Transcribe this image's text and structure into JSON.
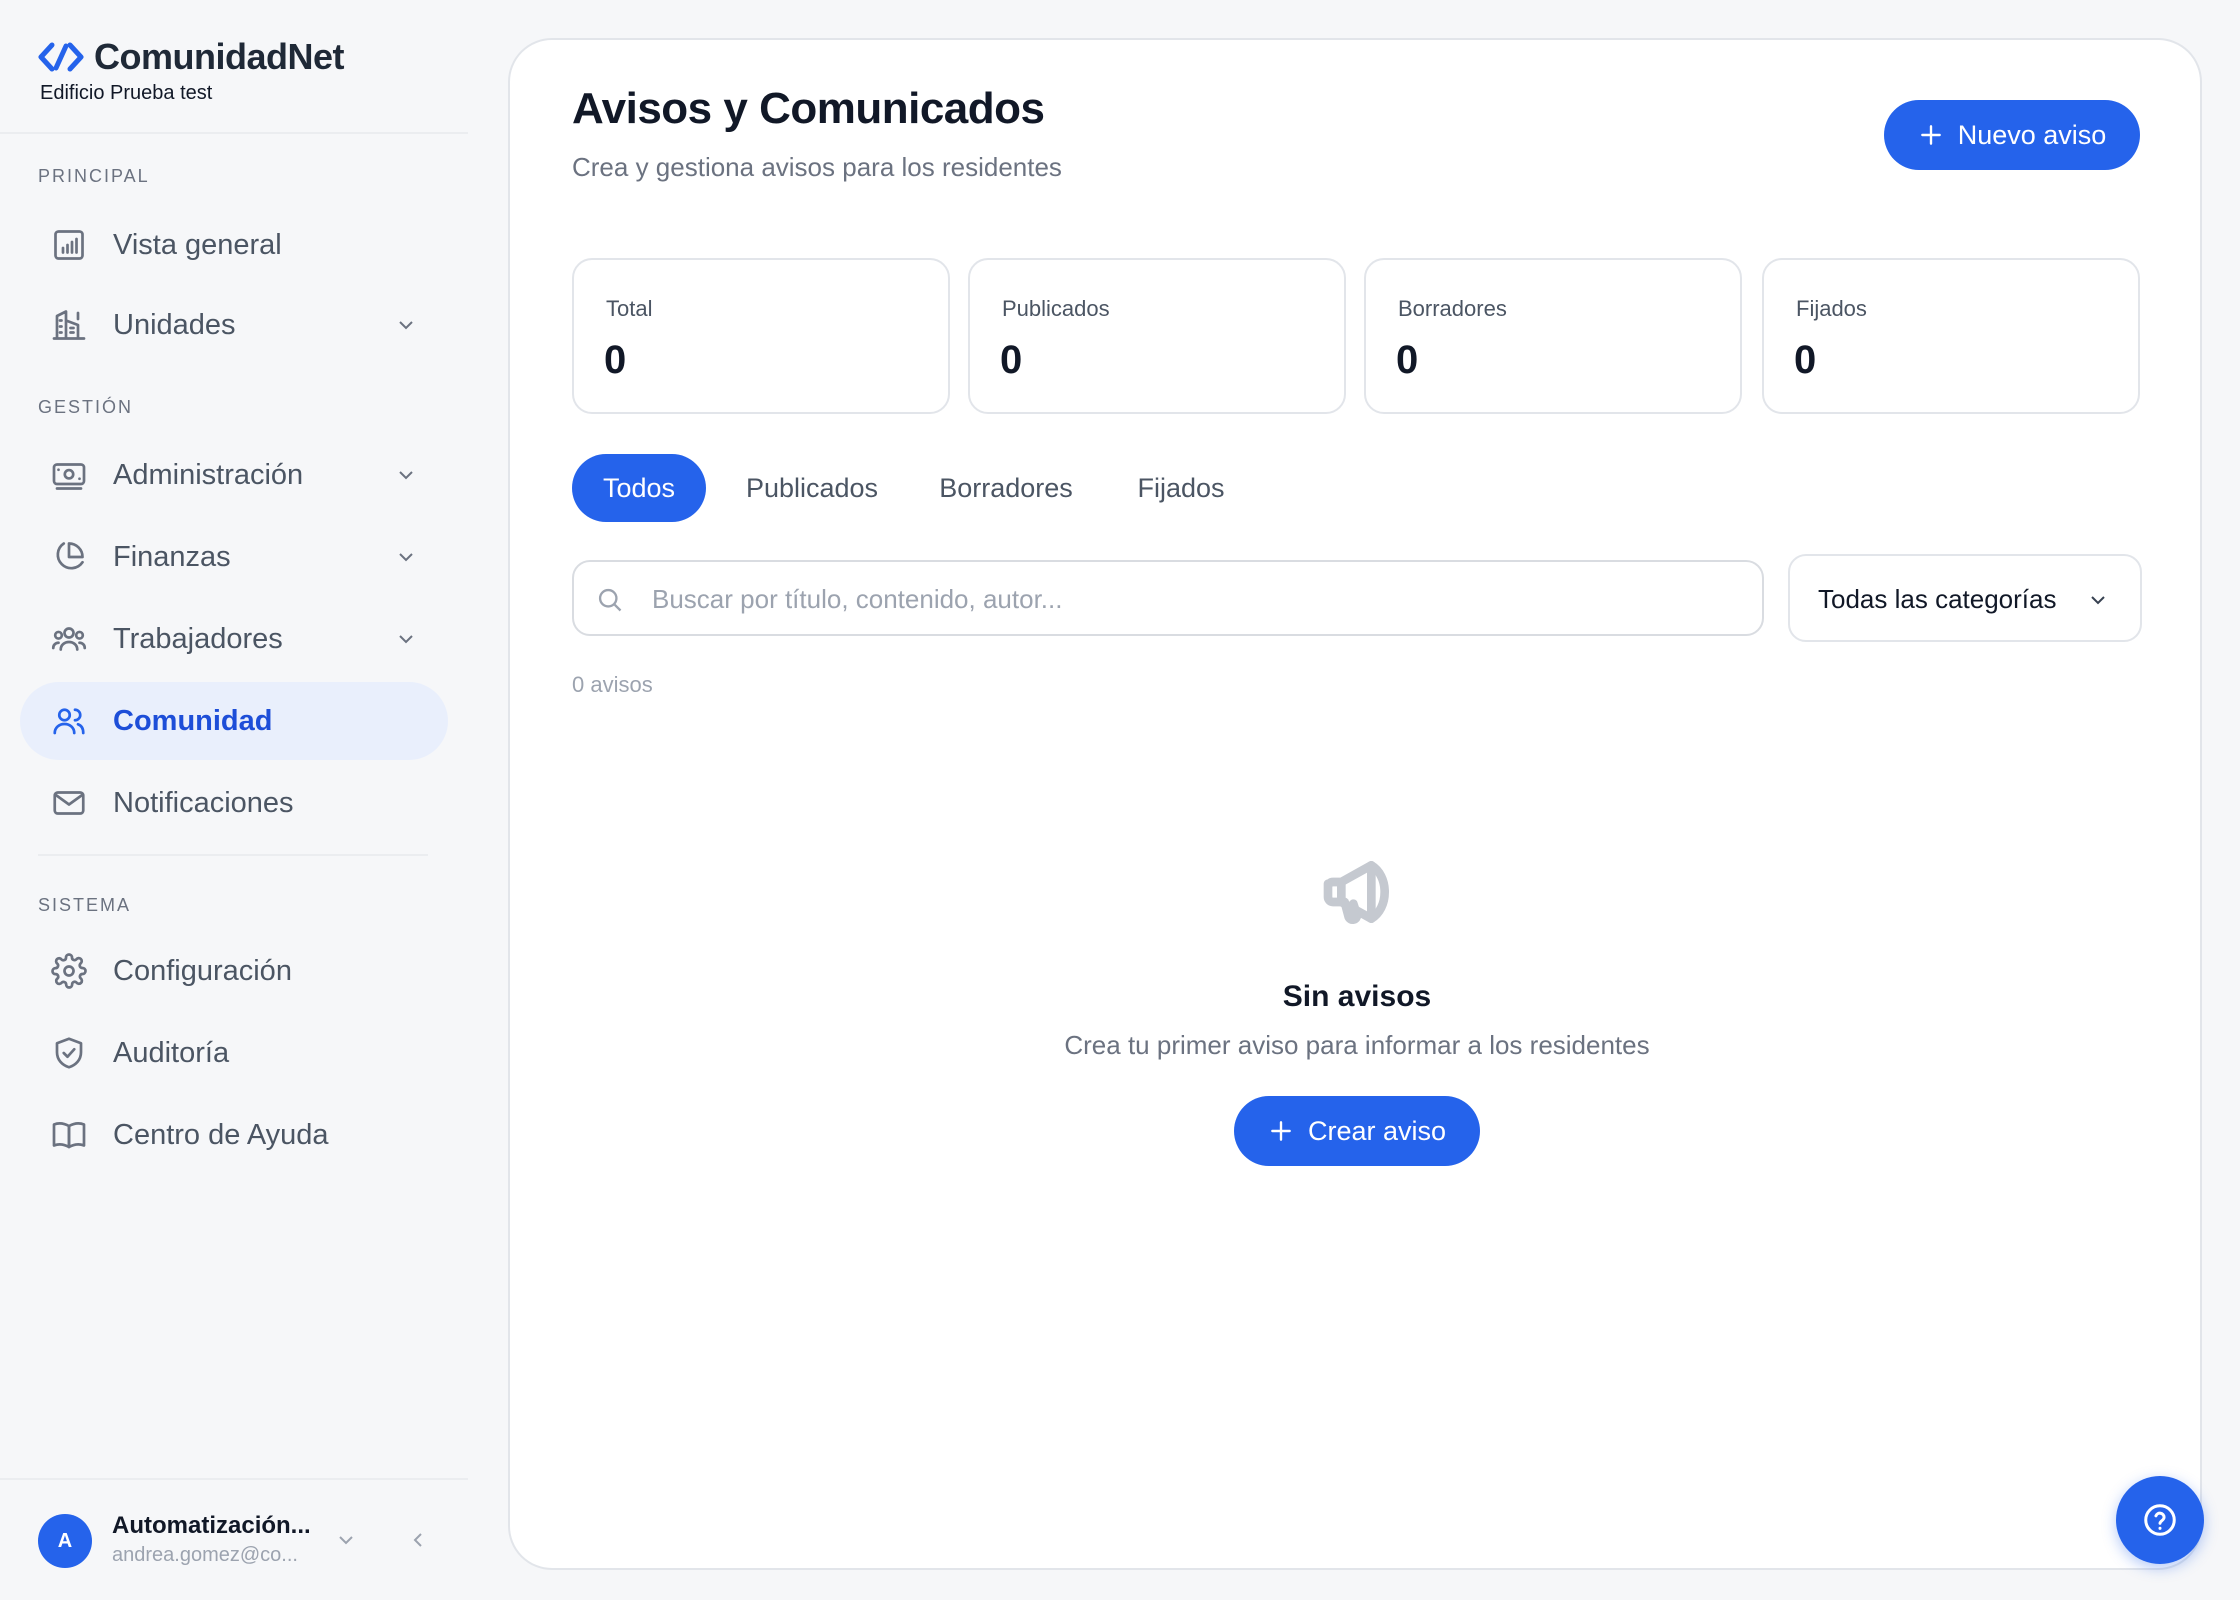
{
  "brand": {
    "name": "ComunidadNet",
    "building": "Edificio Prueba test",
    "accent": "#2563eb"
  },
  "sidebar": {
    "sections": [
      {
        "title": "PRINCIPAL"
      },
      {
        "title": "GESTIÓN"
      },
      {
        "title": "SISTEMA"
      }
    ],
    "items": [
      {
        "label": "Vista general",
        "icon": "bar-chart-icon",
        "expandable": false
      },
      {
        "label": "Unidades",
        "icon": "building-icon",
        "expandable": true
      },
      {
        "label": "Administración",
        "icon": "banknote-icon",
        "expandable": true
      },
      {
        "label": "Finanzas",
        "icon": "pie-chart-icon",
        "expandable": true
      },
      {
        "label": "Trabajadores",
        "icon": "team-icon",
        "expandable": true
      },
      {
        "label": "Comunidad",
        "icon": "users-icon",
        "expandable": false,
        "active": true
      },
      {
        "label": "Notificaciones",
        "icon": "mail-icon",
        "expandable": false
      },
      {
        "label": "Configuración",
        "icon": "gear-icon",
        "expandable": false
      },
      {
        "label": "Auditoría",
        "icon": "shield-check-icon",
        "expandable": false
      },
      {
        "label": "Centro de Ayuda",
        "icon": "book-icon",
        "expandable": false
      }
    ]
  },
  "user": {
    "initial": "A",
    "name": "Automatización...",
    "email": "andrea.gomez@co..."
  },
  "header": {
    "title": "Avisos y Comunicados",
    "subtitle": "Crea y gestiona avisos para los residentes",
    "new_button": "Nuevo aviso"
  },
  "stats": [
    {
      "label": "Total",
      "value": "0"
    },
    {
      "label": "Publicados",
      "value": "0"
    },
    {
      "label": "Borradores",
      "value": "0"
    },
    {
      "label": "Fijados",
      "value": "0"
    }
  ],
  "tabs": [
    {
      "label": "Todos",
      "active": true
    },
    {
      "label": "Publicados"
    },
    {
      "label": "Borradores"
    },
    {
      "label": "Fijados"
    }
  ],
  "search": {
    "placeholder": "Buscar por título, contenido, autor...",
    "value": ""
  },
  "category_filter": {
    "selected": "Todas las categorías"
  },
  "count_text": "0 avisos",
  "empty_state": {
    "icon": "megaphone-icon",
    "title": "Sin avisos",
    "subtitle": "Crea tu primer aviso para informar a los residentes",
    "button": "Crear aviso"
  }
}
